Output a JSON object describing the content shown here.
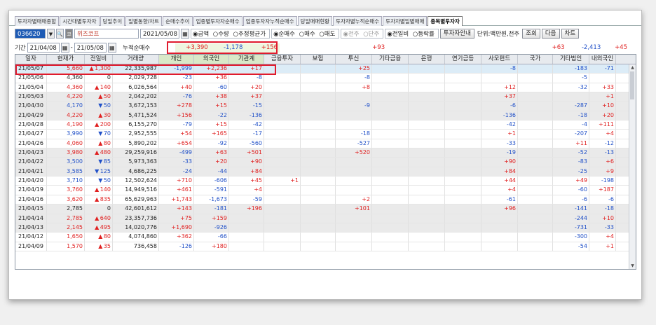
{
  "tabs": [
    "투자자별매매종합",
    "시간대별투자자",
    "당일추이",
    "일별동향/차트",
    "순매수추이",
    "업종별투자자순매수",
    "업종투자자누적순매수",
    "당일매매현황",
    "투자자별누적순매수",
    "투자자별일별매매",
    "종목별투자자"
  ],
  "active_tab": "종목별투자자",
  "toolbar": {
    "code": "036620",
    "name": "위즈코프",
    "date": "2021/05/08",
    "amount_options": [
      "금액",
      "수량",
      "추정평균가"
    ],
    "trade_options": [
      "순매수",
      "매수",
      "매도"
    ],
    "unit_options": [
      "천주",
      "단주"
    ],
    "compare_options": [
      "전일비",
      "등락률"
    ],
    "investor_info_button": "투자자안내",
    "unit_text": "단위:백만원,천주",
    "query_button": "조회",
    "next_button": "다음",
    "chart_button": "차트"
  },
  "period": {
    "label": "기간",
    "from": "21/04/08",
    "to": "21/05/08",
    "sum_label": "누적순매수"
  },
  "sums": [
    "+3,390",
    "-1,178",
    "+156",
    "",
    "",
    "+93",
    "",
    "",
    "",
    "",
    "+63",
    "",
    "-2,413",
    "+45"
  ],
  "headers": [
    "일자",
    "현재가",
    "전일비",
    "거래량",
    "개인",
    "외국인",
    "기관계",
    "금융투자",
    "보험",
    "투신",
    "기타금융",
    "은행",
    "연기금등",
    "사모펀드",
    "국가",
    "기타법인",
    "내외국인"
  ],
  "rows": [
    {
      "date": "21/05/07",
      "price": "5,660",
      "dir": "up",
      "chg": "1,300",
      "vol": "22,335,987",
      "v": [
        "-1,999",
        "+2,236",
        "+17",
        "",
        "",
        "+25",
        "",
        "",
        "",
        "-8",
        "",
        "-183",
        "-71"
      ]
    },
    {
      "date": "21/05/06",
      "price": "4,360",
      "dir": "",
      "chg": "0",
      "vol": "2,029,728",
      "v": [
        "-23",
        "+36",
        "-8",
        "",
        "",
        "-8",
        "",
        "",
        "",
        "",
        "",
        "-5",
        ""
      ]
    },
    {
      "date": "21/05/04",
      "price": "4,360",
      "dir": "up",
      "chg": "140",
      "vol": "6,026,564",
      "v": [
        "+40",
        "-60",
        "+20",
        "",
        "",
        "+8",
        "",
        "",
        "",
        "+12",
        "",
        "-32",
        "+33"
      ]
    },
    {
      "date": "21/05/03",
      "price": "4,220",
      "dir": "up",
      "chg": "50",
      "vol": "2,042,202",
      "v": [
        "-76",
        "+38",
        "+37",
        "",
        "",
        "",
        "",
        "",
        "",
        "+37",
        "",
        "",
        "+1"
      ]
    },
    {
      "date": "21/04/30",
      "price": "4,170",
      "dir": "dn",
      "chg": "50",
      "vol": "3,672,153",
      "v": [
        "+278",
        "+15",
        "-15",
        "",
        "",
        "-9",
        "",
        "",
        "",
        "-6",
        "",
        "-287",
        "+10"
      ]
    },
    {
      "date": "21/04/29",
      "price": "4,220",
      "dir": "up",
      "chg": "30",
      "vol": "5,471,524",
      "v": [
        "+156",
        "-22",
        "-136",
        "",
        "",
        "",
        "",
        "",
        "",
        "-136",
        "",
        "-18",
        "+20"
      ]
    },
    {
      "date": "21/04/28",
      "price": "4,190",
      "dir": "up",
      "chg": "200",
      "vol": "6,155,270",
      "v": [
        "-79",
        "+15",
        "-42",
        "",
        "",
        "",
        "",
        "",
        "",
        "-42",
        "",
        "-4",
        "+111"
      ]
    },
    {
      "date": "21/04/27",
      "price": "3,990",
      "dir": "dn",
      "chg": "70",
      "vol": "2,952,555",
      "v": [
        "+54",
        "+165",
        "-17",
        "",
        "",
        "-18",
        "",
        "",
        "",
        "+1",
        "",
        "-207",
        "+4"
      ]
    },
    {
      "date": "21/04/26",
      "price": "4,060",
      "dir": "up",
      "chg": "80",
      "vol": "5,890,202",
      "v": [
        "+654",
        "-92",
        "-560",
        "",
        "",
        "-527",
        "",
        "",
        "",
        "-33",
        "",
        "+11",
        "-12"
      ]
    },
    {
      "date": "21/04/23",
      "price": "3,980",
      "dir": "up",
      "chg": "480",
      "vol": "29,259,916",
      "v": [
        "-499",
        "+63",
        "+501",
        "",
        "",
        "+520",
        "",
        "",
        "",
        "-19",
        "",
        "-52",
        "-13"
      ]
    },
    {
      "date": "21/04/22",
      "price": "3,500",
      "dir": "dn",
      "chg": "85",
      "vol": "5,973,363",
      "v": [
        "-33",
        "+20",
        "+90",
        "",
        "",
        "",
        "",
        "",
        "",
        "+90",
        "",
        "-83",
        "+6"
      ]
    },
    {
      "date": "21/04/21",
      "price": "3,585",
      "dir": "dn",
      "chg": "125",
      "vol": "4,686,225",
      "v": [
        "-24",
        "-44",
        "+84",
        "",
        "",
        "",
        "",
        "",
        "",
        "+84",
        "",
        "-25",
        "+9"
      ]
    },
    {
      "date": "21/04/20",
      "price": "3,710",
      "dir": "dn",
      "chg": "50",
      "vol": "12,502,624",
      "v": [
        "+710",
        "-606",
        "+45",
        "+1",
        "",
        "",
        "",
        "",
        "",
        "+44",
        "",
        "+49",
        "-198"
      ]
    },
    {
      "date": "21/04/19",
      "price": "3,760",
      "dir": "up",
      "chg": "140",
      "vol": "14,949,516",
      "v": [
        "+461",
        "-591",
        "+4",
        "",
        "",
        "",
        "",
        "",
        "",
        "+4",
        "",
        "-60",
        "+187"
      ]
    },
    {
      "date": "21/04/16",
      "price": "3,620",
      "dir": "up",
      "chg": "835",
      "vol": "65,629,963",
      "v": [
        "+1,743",
        "-1,673",
        "-59",
        "",
        "",
        "+2",
        "",
        "",
        "",
        "-61",
        "",
        "-6",
        "-6"
      ]
    },
    {
      "date": "21/04/15",
      "price": "2,785",
      "dir": "",
      "chg": "0",
      "vol": "42,601,612",
      "v": [
        "+143",
        "-181",
        "+196",
        "",
        "",
        "+101",
        "",
        "",
        "",
        "+96",
        "",
        "-141",
        "-18"
      ]
    },
    {
      "date": "21/04/14",
      "price": "2,785",
      "dir": "up",
      "chg": "640",
      "vol": "23,357,736",
      "v": [
        "+75",
        "+159",
        "",
        "",
        "",
        "",
        "",
        "",
        "",
        "",
        "",
        "-244",
        "+10"
      ]
    },
    {
      "date": "21/04/13",
      "price": "2,145",
      "dir": "up",
      "chg": "495",
      "vol": "14,020,776",
      "v": [
        "+1,690",
        "-926",
        "",
        "",
        "",
        "",
        "",
        "",
        "",
        "",
        "",
        "-731",
        "-33"
      ]
    },
    {
      "date": "21/04/12",
      "price": "1,650",
      "dir": "up",
      "chg": "80",
      "vol": "4,074,860",
      "v": [
        "+362",
        "-66",
        "",
        "",
        "",
        "",
        "",
        "",
        "",
        "",
        "",
        "-300",
        "+4"
      ]
    },
    {
      "date": "21/04/09",
      "price": "1,570",
      "dir": "up",
      "chg": "35",
      "vol": "736,458",
      "v": [
        "-126",
        "+180",
        "",
        "",
        "",
        "",
        "",
        "",
        "",
        "",
        "",
        "-54",
        "+1"
      ]
    }
  ]
}
